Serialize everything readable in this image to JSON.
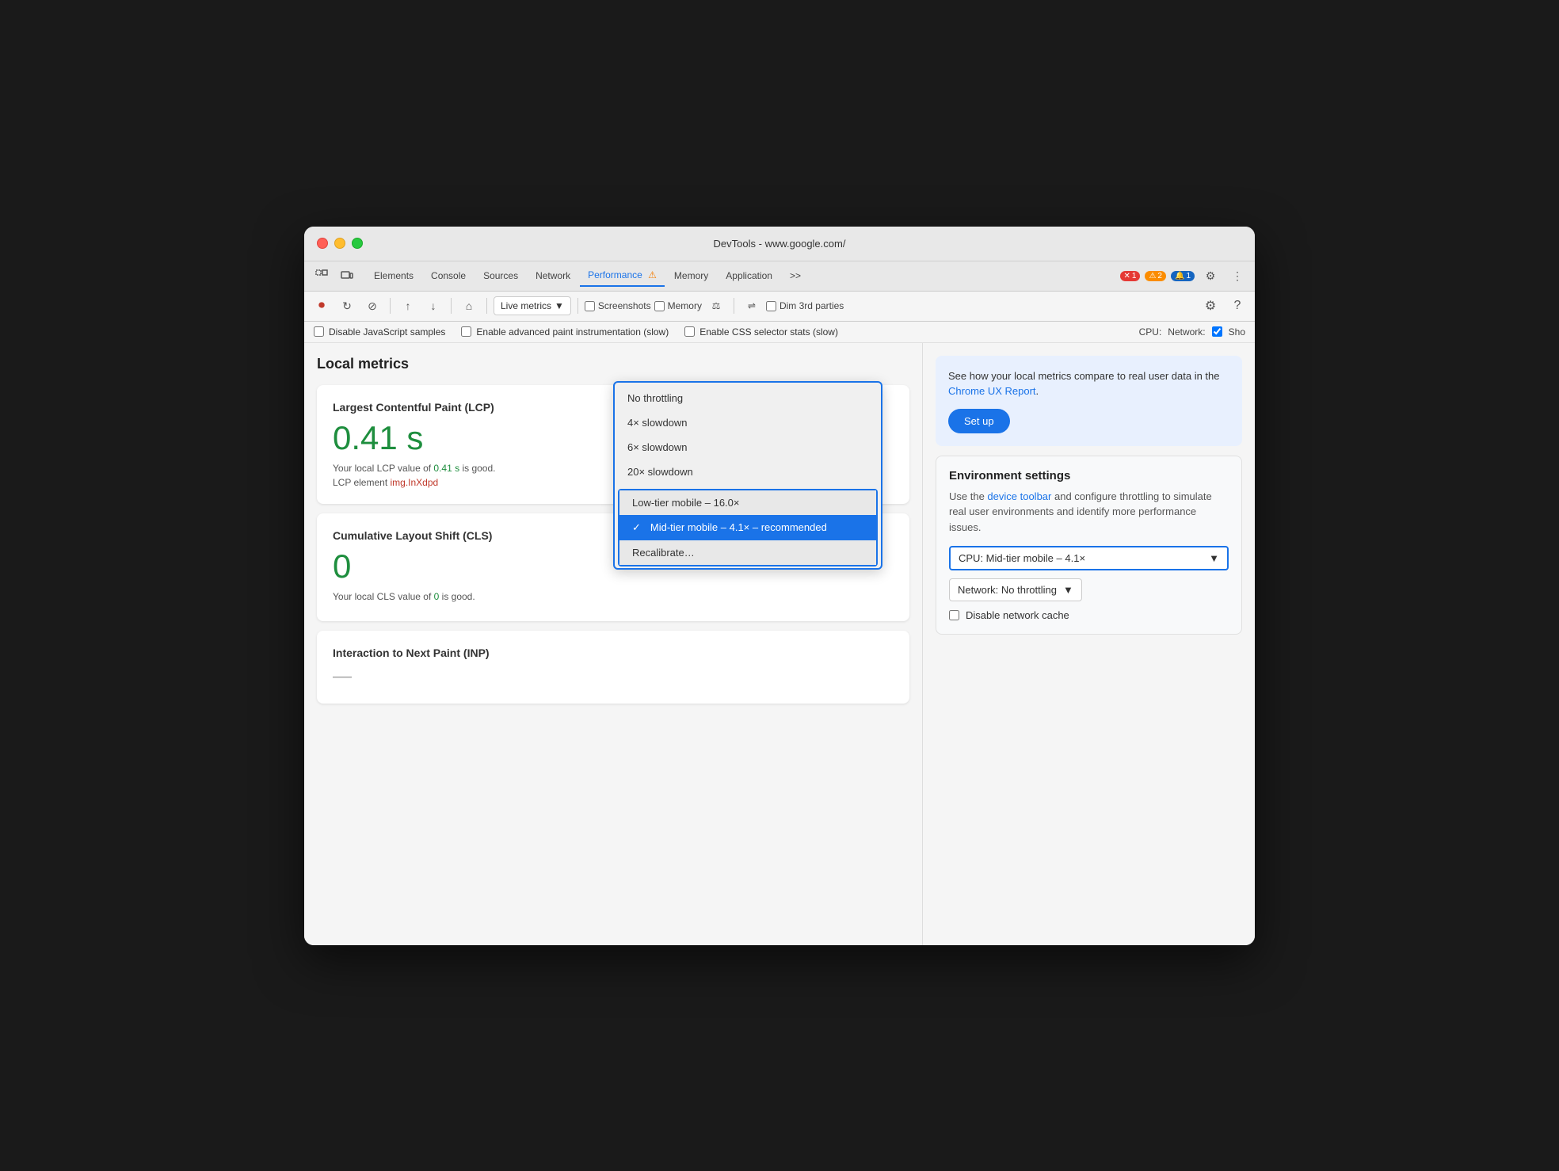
{
  "window": {
    "title": "DevTools - www.google.com/"
  },
  "tabs": {
    "items": [
      {
        "label": "Elements",
        "active": false
      },
      {
        "label": "Console",
        "active": false
      },
      {
        "label": "Sources",
        "active": false
      },
      {
        "label": "Network",
        "active": false
      },
      {
        "label": "Performance ⚠",
        "active": true
      },
      {
        "label": "Memory",
        "active": false
      },
      {
        "label": "Application",
        "active": false
      },
      {
        "label": ">>",
        "active": false
      }
    ],
    "badges": {
      "red": "1",
      "yellow": "2",
      "blue": "1"
    }
  },
  "toolbar": {
    "live_metrics_label": "Live metrics",
    "screenshots_label": "Screenshots",
    "memory_label": "Memory",
    "dim_3rd_label": "Dim 3rd parties"
  },
  "options": {
    "disable_js_label": "Disable JavaScript samples",
    "enable_paint_label": "Enable advanced paint instrumentation (slow)",
    "enable_css_label": "Enable CSS selector stats (slow)",
    "cpu_label": "CPU:",
    "network_label": "Network:",
    "show_label": "Sho"
  },
  "local_metrics": {
    "title": "Local metrics",
    "lcp": {
      "title": "Largest Contentful Paint (LCP)",
      "value": "0.41 s",
      "desc_before": "Your local LCP value of ",
      "desc_value": "0.41 s",
      "desc_after": " is good.",
      "element_label": "LCP element",
      "element_value": "img.InXdpd"
    },
    "cls": {
      "title": "Cumulative Layout Shift (CLS)",
      "value": "0",
      "desc_before": "Your local CLS value of ",
      "desc_value": "0",
      "desc_after": " is good."
    },
    "inp": {
      "title": "Interaction to Next Paint (INP)",
      "value": "—"
    }
  },
  "ux_report": {
    "text_before": "See how your local metrics compare to real user data in the ",
    "link_text": "Chrome UX Report",
    "text_after": ".",
    "button_label": "Set up"
  },
  "env_settings": {
    "title": "Environment settings",
    "desc_before": "Use the ",
    "link_text": "device toolbar",
    "desc_after": " and configure throttling to simulate real user environments and identify more performance issues.",
    "cpu_label": "CPU: Mid-tier mobile – 4.1×",
    "network_label": "Network: No throttling",
    "disable_cache_label": "Disable network cache"
  },
  "dropdown": {
    "items": [
      {
        "label": "No throttling",
        "selected": false,
        "section_border": false
      },
      {
        "label": "4× slowdown",
        "selected": false,
        "section_border": false
      },
      {
        "label": "6× slowdown",
        "selected": false,
        "section_border": false
      },
      {
        "label": "20× slowdown",
        "selected": false,
        "section_border": false
      },
      {
        "label": "Low-tier mobile – 16.0×",
        "selected": false,
        "section_border": true
      },
      {
        "label": "✓ Mid-tier mobile – 4.1× – recommended",
        "selected": true,
        "section_border": false
      },
      {
        "label": "Recalibrate…",
        "selected": false,
        "section_border": false
      }
    ]
  }
}
